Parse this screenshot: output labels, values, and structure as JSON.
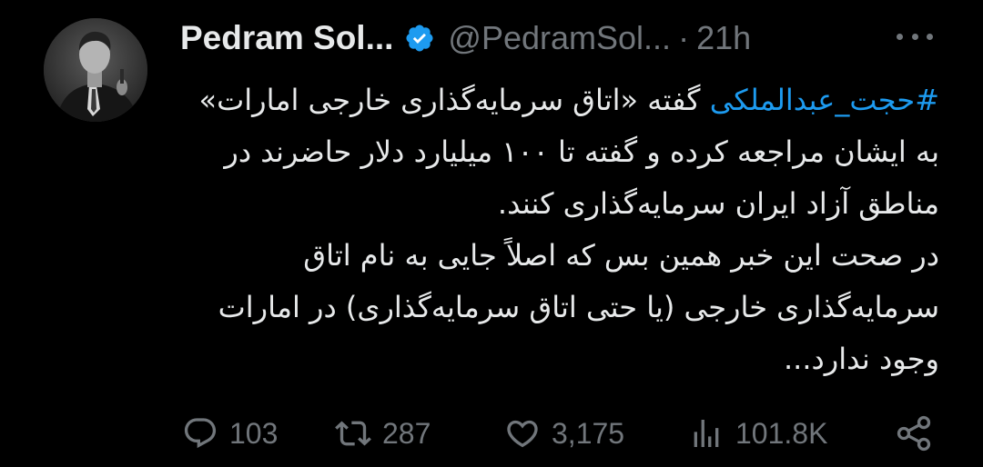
{
  "user": {
    "display_name": "Pedram Sol...",
    "handle": "@PedramSol...",
    "separator": "·",
    "time": "21h",
    "verified": true
  },
  "tweet": {
    "hashtag": "#حجت_عبدالملکی",
    "body_first": " گفته «اتاق سرمایه‌گذاری خارجی امارات» به ایشان مراجعه کرده و گفته تا ۱۰۰ میلیارد دلار حاضرند در مناطق آزاد ایران سرمایه‌گذاری کنند.",
    "body_second": "در صحت این خبر همین بس که اصلاً جایی به نام اتاق سرمایه‌گذاری خارجی (یا حتی اتاق سرمایه‌گذاری) در امارات وجود ندارد..."
  },
  "actions": {
    "replies": "103",
    "retweets": "287",
    "likes": "3,175",
    "views": "101.8K"
  },
  "icons": {
    "avatar": "profile-photo",
    "verified": "verified-badge-icon",
    "more": "more-dots-icon",
    "reply": "reply-icon",
    "retweet": "retweet-icon",
    "like": "heart-icon",
    "views": "views-chart-icon",
    "share": "share-icon"
  },
  "colors": {
    "background": "#000000",
    "text": "#e7e9ea",
    "muted": "#71767b",
    "accent": "#1d9bf0"
  }
}
